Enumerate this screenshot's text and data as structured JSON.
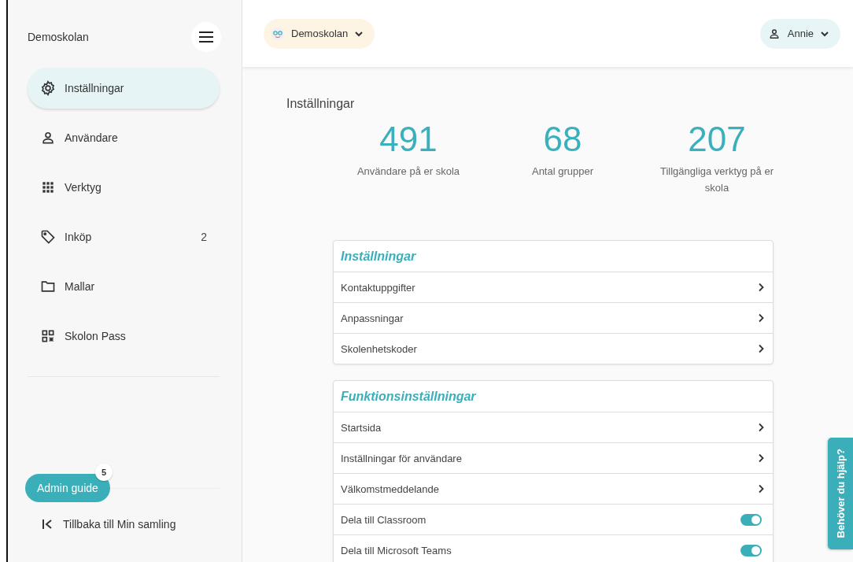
{
  "sidebar": {
    "school": "Demoskolan",
    "items": [
      {
        "label": "Inställningar",
        "selected": true
      },
      {
        "label": "Användare",
        "selected": false
      },
      {
        "label": "Verktyg",
        "selected": false
      },
      {
        "label": "Inköp",
        "selected": false,
        "count": "2"
      },
      {
        "label": "Mallar",
        "selected": false
      },
      {
        "label": "Skolon Pass",
        "selected": false
      }
    ],
    "guide": {
      "label": "Admin guide",
      "badge": "5"
    },
    "back": "Tillbaka till Min samling"
  },
  "topbar": {
    "school": "Demoskolan",
    "user": "Annie"
  },
  "page": {
    "title": "Inställningar",
    "stats": [
      {
        "value": "491",
        "label": "Användare på er skola"
      },
      {
        "value": "68",
        "label": "Antal grupper"
      },
      {
        "value": "207",
        "label": "Tillgängliga verktyg på er skola"
      }
    ],
    "sections": [
      {
        "title": "Inställningar",
        "rows": [
          {
            "kind": "link",
            "label": "Kontaktuppgifter"
          },
          {
            "kind": "link",
            "label": "Anpassningar"
          },
          {
            "kind": "link",
            "label": "Skolenhetskoder"
          }
        ]
      },
      {
        "title": "Funktionsinställningar",
        "rows": [
          {
            "kind": "link",
            "label": "Startsida"
          },
          {
            "kind": "link",
            "label": "Inställningar för användare"
          },
          {
            "kind": "link",
            "label": "Välkomstmeddelande"
          },
          {
            "kind": "toggle",
            "label": "Dela till Classroom",
            "on": true
          },
          {
            "kind": "toggle",
            "label": "Dela till Microsoft Teams",
            "on": true
          }
        ]
      }
    ]
  },
  "help_tab": "Behöver du hjälp?"
}
